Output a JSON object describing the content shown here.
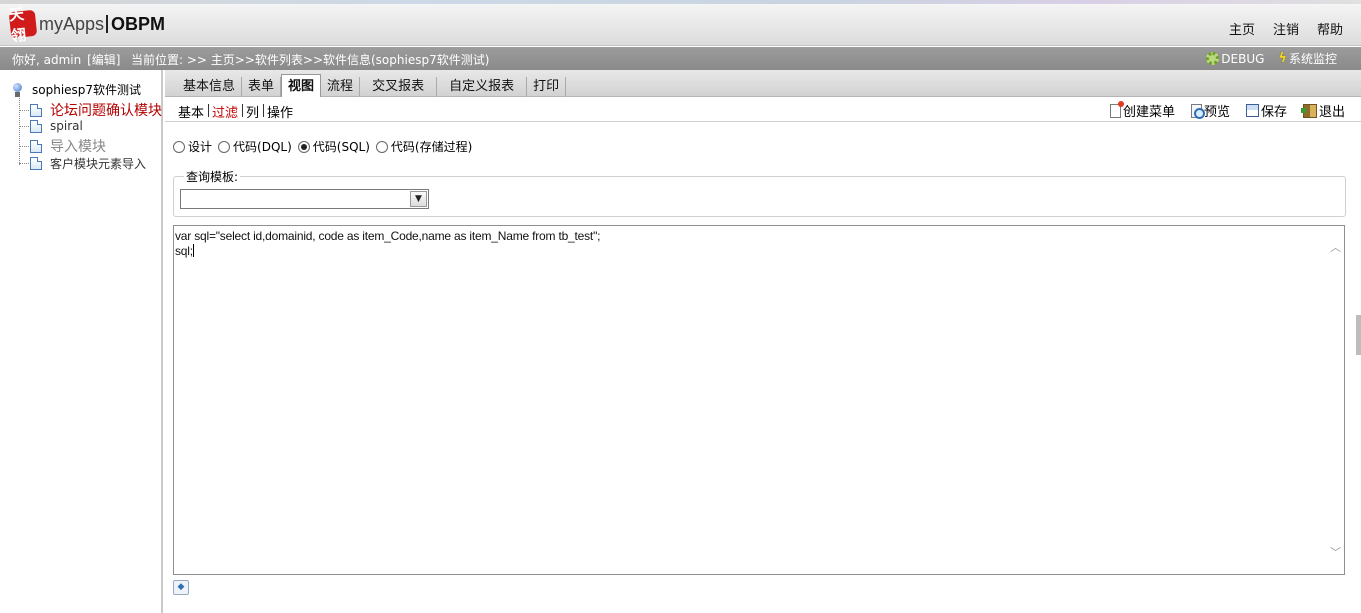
{
  "header": {
    "logo_mark": "天翎",
    "logo_text": "myApps",
    "logo_text2": "OBPM",
    "nav": [
      "主页",
      "注销",
      "帮助"
    ]
  },
  "infobar": {
    "greeting": "你好, admin",
    "edit_label": "[编辑]",
    "location": "当前位置: >> 主页>>软件列表>>软件信息(sophiesp7软件测试)",
    "debug_label": "DEBUG",
    "monitor_label": "系统监控"
  },
  "tree": {
    "root": "sophiesp7软件测试",
    "items": [
      {
        "label": "论坛问题确认模块",
        "state": "active"
      },
      {
        "label": "spiral",
        "state": "normal"
      },
      {
        "label": "导入模块",
        "state": "muted"
      },
      {
        "label": "客户模块元素导入",
        "state": "normal"
      }
    ]
  },
  "tabs": {
    "items": [
      "基本信息",
      "表单",
      "视图",
      "流程",
      "交叉报表",
      "自定义报表",
      "打印"
    ],
    "active": "视图"
  },
  "subtabs": {
    "items": [
      "基本",
      "过滤",
      "列",
      "操作"
    ],
    "active": "过滤"
  },
  "actions": {
    "create_menu": "创建菜单",
    "preview": "预览",
    "save": "保存",
    "exit": "退出"
  },
  "mode": {
    "options": [
      "设计",
      "代码(DQL)",
      "代码(SQL)",
      "代码(存储过程)"
    ],
    "selected": "代码(SQL)"
  },
  "query_template": {
    "legend": "查询模板:",
    "selected": ""
  },
  "editor": {
    "line1": "var sql=\"select id,domainid, code as item_Code,name as item_Name from tb_test\";",
    "line2": "sql;"
  },
  "colors": {
    "active_red": "#b40000",
    "infobar_gray": "#8f8f8f",
    "logo_red": "#d11b1b"
  }
}
